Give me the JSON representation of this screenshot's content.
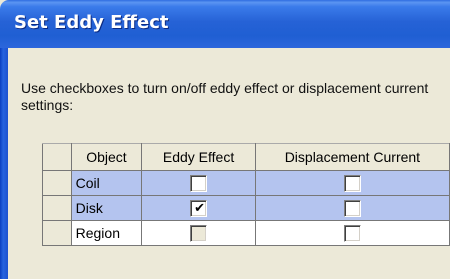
{
  "window": {
    "title": "Set Eddy Effect"
  },
  "instructions": "Use checkboxes to turn on/off eddy effect or displacement current settings:",
  "table": {
    "headers": {
      "selector": "",
      "object": "Object",
      "eddy": "Eddy Effect",
      "displacement": "Displacement Current"
    },
    "rows": [
      {
        "object": "Coil",
        "eddy_checked": false,
        "eddy_enabled": true,
        "displacement_checked": false,
        "displacement_enabled": true,
        "highlighted": true
      },
      {
        "object": "Disk",
        "eddy_checked": true,
        "eddy_enabled": true,
        "displacement_checked": false,
        "displacement_enabled": true,
        "highlighted": true
      },
      {
        "object": "Region",
        "eddy_checked": false,
        "eddy_enabled": false,
        "displacement_checked": false,
        "displacement_enabled": true,
        "highlighted": false
      }
    ]
  },
  "colors": {
    "title_bar": "#2662d6",
    "row_highlight": "#b4c4ef",
    "dialog_bg": "#ece9d8"
  },
  "icons": {
    "check": "✔"
  }
}
